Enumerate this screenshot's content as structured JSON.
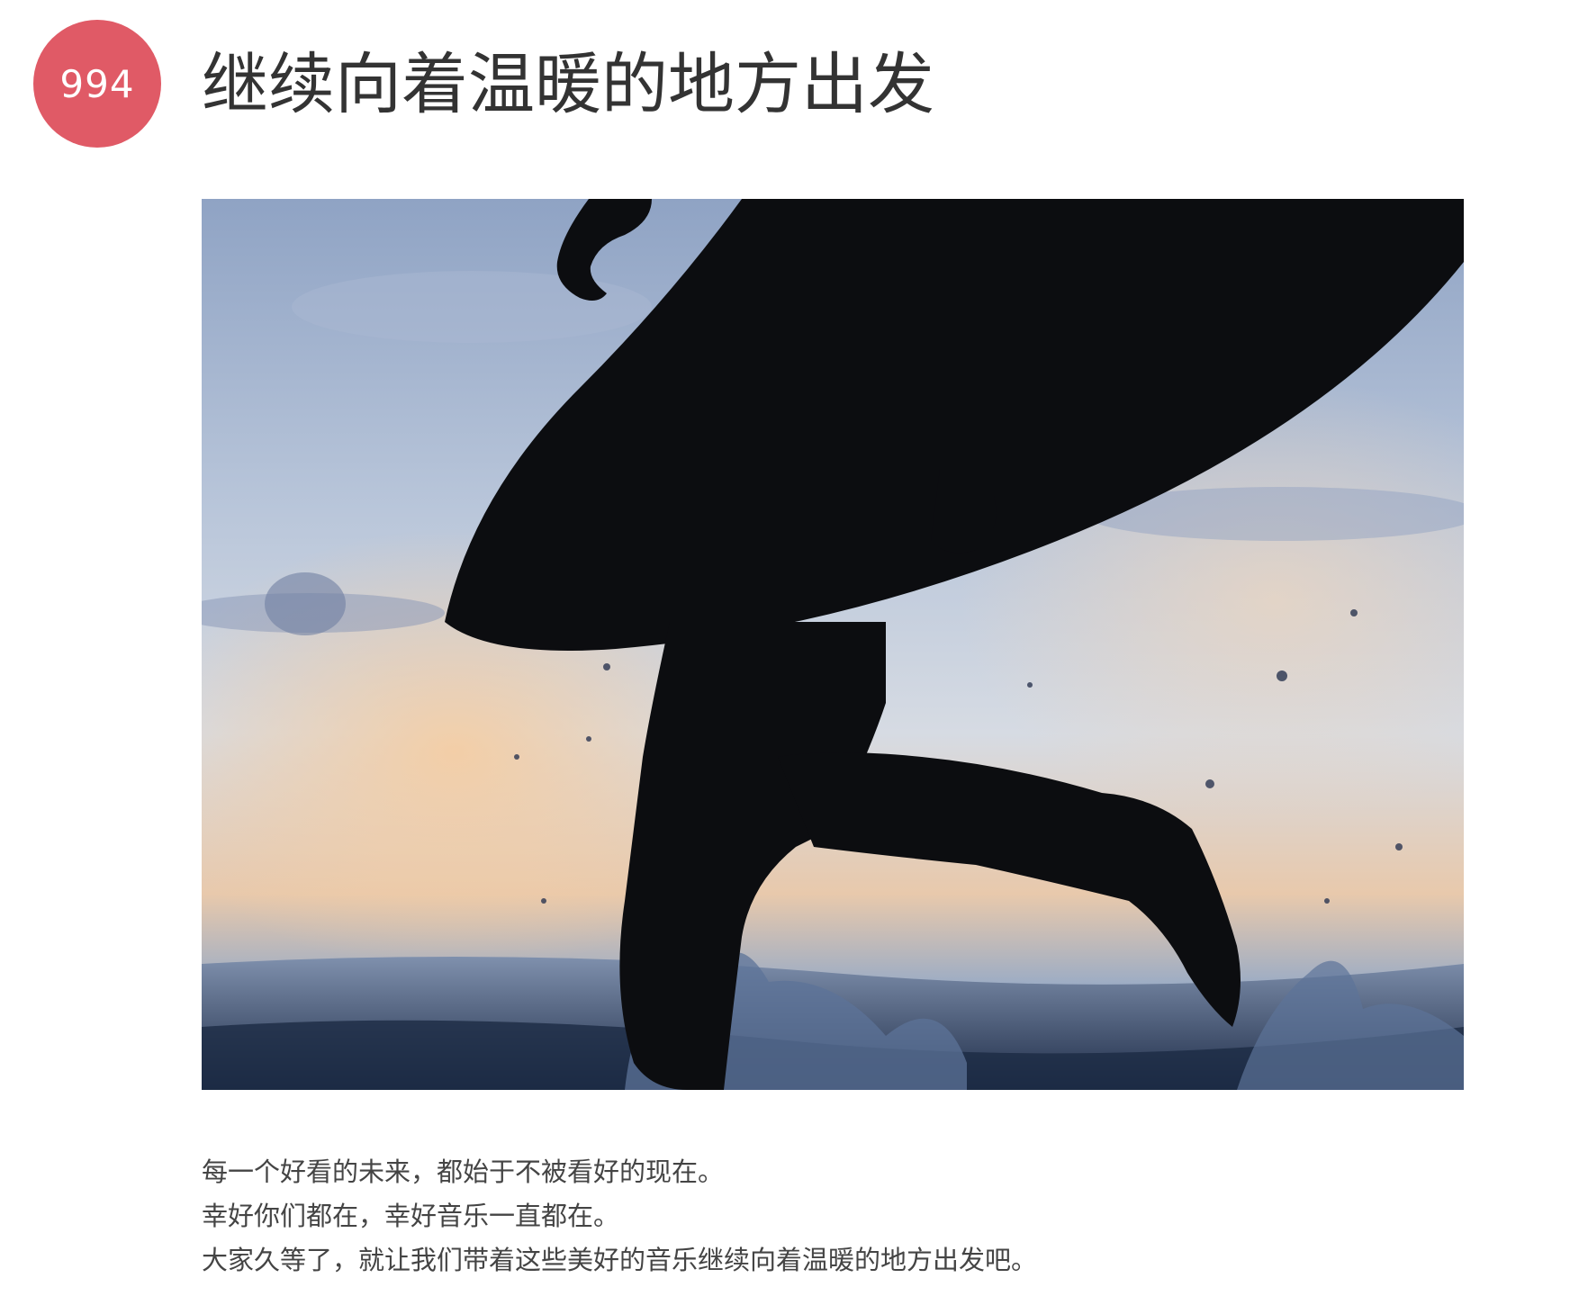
{
  "post": {
    "number": "994",
    "title": "继续向着温暖的地方出发",
    "paragraphs": [
      "每一个好看的未来，都始于不被看好的现在。",
      "幸好你们都在，幸好音乐一直都在。",
      "大家久等了，就让我们带着这些美好的音乐继续向着温暖的地方出发吧。"
    ]
  },
  "colors": {
    "badge": "#e05a66",
    "title": "#333333",
    "text": "#444444"
  },
  "image": {
    "subject": "silhouette of a surfer running into the sea carrying a surfboard at dusk"
  }
}
